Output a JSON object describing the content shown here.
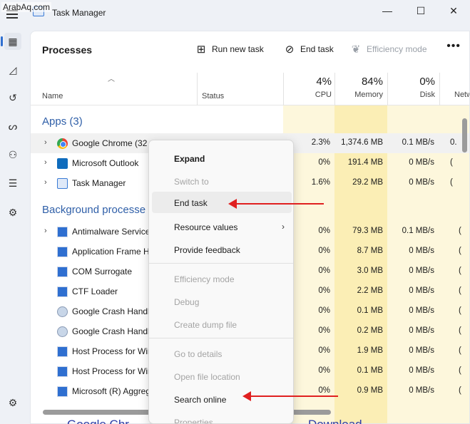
{
  "watermark": "ArabAq.com",
  "window": {
    "title": "Task Manager",
    "minimize": "—",
    "maximize": "☐",
    "close": "✕"
  },
  "sidebar": {
    "items": [
      {
        "name": "processes",
        "icon": "▦"
      },
      {
        "name": "performance",
        "icon": "◿"
      },
      {
        "name": "app-history",
        "icon": "↺"
      },
      {
        "name": "startup-apps",
        "icon": "ᔕ"
      },
      {
        "name": "users",
        "icon": "⚇"
      },
      {
        "name": "details",
        "icon": "☰"
      },
      {
        "name": "services",
        "icon": "⚙"
      }
    ],
    "settings_icon": "⚙"
  },
  "toolbar": {
    "title": "Processes",
    "run_new_task": "Run new task",
    "end_task": "End task",
    "efficiency_mode": "Efficiency mode",
    "more": "•••"
  },
  "header": {
    "name": "Name",
    "status": "Status",
    "cpu_pct": "4%",
    "cpu": "CPU",
    "mem_pct": "84%",
    "memory": "Memory",
    "disk_pct": "0%",
    "disk": "Disk",
    "network": "Netw"
  },
  "groups": {
    "apps": "Apps (3)",
    "background": "Background processe"
  },
  "apps": [
    {
      "name": "Google Chrome (32",
      "cpu": "2.3%",
      "memory": "1,374.6 MB",
      "disk": "0.1 MB/s",
      "net": "0."
    },
    {
      "name": "Microsoft Outlook",
      "cpu": "0%",
      "memory": "191.4 MB",
      "disk": "0 MB/s",
      "net": "("
    },
    {
      "name": "Task Manager",
      "cpu": "1.6%",
      "memory": "29.2 MB",
      "disk": "0 MB/s",
      "net": "("
    }
  ],
  "background": [
    {
      "name": "Antimalware Service",
      "cpu": "0%",
      "memory": "79.3 MB",
      "disk": "0.1 MB/s",
      "net": "("
    },
    {
      "name": "Application Frame H",
      "cpu": "0%",
      "memory": "8.7 MB",
      "disk": "0 MB/s",
      "net": "("
    },
    {
      "name": "COM Surrogate",
      "cpu": "0%",
      "memory": "3.0 MB",
      "disk": "0 MB/s",
      "net": "("
    },
    {
      "name": "CTF Loader",
      "cpu": "0%",
      "memory": "2.2 MB",
      "disk": "0 MB/s",
      "net": "("
    },
    {
      "name": "Google Crash Handl",
      "cpu": "0%",
      "memory": "0.1 MB",
      "disk": "0 MB/s",
      "net": "("
    },
    {
      "name": "Google Crash Handl",
      "cpu": "0%",
      "memory": "0.2 MB",
      "disk": "0 MB/s",
      "net": "("
    },
    {
      "name": "Host Process for Wir",
      "cpu": "0%",
      "memory": "1.9 MB",
      "disk": "0 MB/s",
      "net": "("
    },
    {
      "name": "Host Process for Wir",
      "cpu": "0%",
      "memory": "0.1 MB",
      "disk": "0 MB/s",
      "net": "("
    },
    {
      "name": "Microsoft (R) Aggreg",
      "cpu": "0%",
      "memory": "0.9 MB",
      "disk": "0 MB/s",
      "net": "("
    }
  ],
  "context_menu": {
    "expand": "Expand",
    "switch_to": "Switch to",
    "end_task": "End task",
    "resource_values": "Resource values",
    "provide_feedback": "Provide feedback",
    "efficiency_mode": "Efficiency mode",
    "debug": "Debug",
    "create_dump_file": "Create dump file",
    "go_to_details": "Go to details",
    "open_file_location": "Open file location",
    "search_online": "Search online",
    "properties": "Properties",
    "submenu_arrow": "›"
  },
  "bottom_text": {
    "left": "Google Chr",
    "right": "Download"
  },
  "colors": {
    "accent": "#2f6fd0",
    "arrow": "#e02020",
    "heat_light": "#fdf7dc",
    "heat_mid": "#fbeeb5"
  }
}
